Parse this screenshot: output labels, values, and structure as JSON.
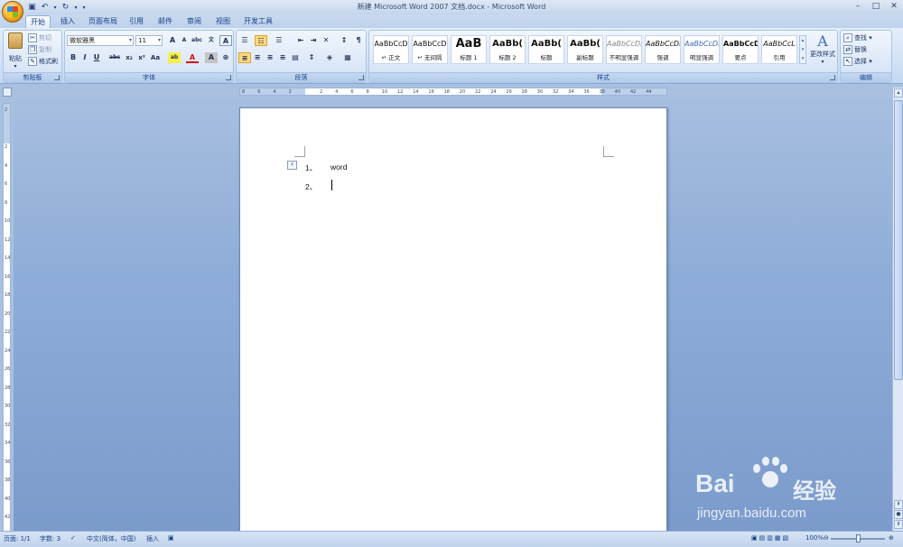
{
  "window": {
    "title": "新建 Microsoft Word 2007 文档.docx - Microsoft Word",
    "controls": [
      "–",
      "□",
      "✕"
    ]
  },
  "qat": {
    "save_icon": "save-icon",
    "undo_icon": "undo-icon",
    "redo_icon": "redo-icon"
  },
  "tabs": [
    {
      "label": "开始",
      "active": true
    },
    {
      "label": "插入"
    },
    {
      "label": "页面布局"
    },
    {
      "label": "引用"
    },
    {
      "label": "邮件"
    },
    {
      "label": "审阅"
    },
    {
      "label": "视图"
    },
    {
      "label": "开发工具"
    }
  ],
  "clipboard": {
    "group_label": "剪贴板",
    "paste": "粘贴",
    "cut": "剪切",
    "copy": "复制",
    "format_painter": "格式刷"
  },
  "font": {
    "group_label": "字体",
    "family": "微软雅黑",
    "size": "11",
    "tools_row1": [
      "A",
      "A",
      "abc",
      "A"
    ],
    "tools_row2": [
      "B",
      "I",
      "U",
      "abc",
      "x₂",
      "x²",
      "Aa",
      "ab",
      "A",
      "A",
      "⊕"
    ]
  },
  "paragraph": {
    "group_label": "段落"
  },
  "styles": {
    "group_label": "样式",
    "items": [
      {
        "sample": "AaBbCcD",
        "name": "↵ 正文"
      },
      {
        "sample": "AaBbCcD",
        "name": "↵ 无间隔"
      },
      {
        "sample": "AaB",
        "name": "标题 1"
      },
      {
        "sample": "AaBb(",
        "name": "标题 2"
      },
      {
        "sample": "AaBb(",
        "name": "标题"
      },
      {
        "sample": "AaBb(",
        "name": "副标题"
      },
      {
        "sample": "AaBbCcDı",
        "name": "不明显强调"
      },
      {
        "sample": "AaBbCcDı",
        "name": "强调"
      },
      {
        "sample": "AaBbCcDı",
        "name": "明显强调"
      },
      {
        "sample": "AaBbCcDc",
        "name": "要点"
      },
      {
        "sample": "AaBbCcL",
        "name": "引用"
      }
    ],
    "change_styles": "更改样式"
  },
  "editing": {
    "group_label": "编辑",
    "find": "查找",
    "replace": "替换",
    "select": "选择"
  },
  "ruler": {
    "h_ticks": [
      "8",
      "6",
      "4",
      "2",
      "",
      "2",
      "4",
      "6",
      "8",
      "10",
      "12",
      "14",
      "16",
      "18",
      "20",
      "22",
      "24",
      "26",
      "28",
      "30",
      "32",
      "34",
      "36",
      "38",
      "40",
      "42",
      "44"
    ],
    "v_ticks": [
      "2",
      "",
      "2",
      "4",
      "6",
      "8",
      "10",
      "12",
      "14",
      "16",
      "18",
      "20",
      "22",
      "24",
      "26",
      "28",
      "30",
      "32",
      "34",
      "36",
      "38",
      "40",
      "42"
    ]
  },
  "document": {
    "autoformat_icon": "autoformat-options-icon",
    "lines": [
      {
        "number": "1、",
        "text": "word"
      },
      {
        "number": "2、",
        "text": ""
      }
    ]
  },
  "statusbar": {
    "page": "页面: 1/1",
    "words": "字数: 3",
    "language": "中文(简体，中国)",
    "mode": "插入",
    "zoom": "100%"
  },
  "watermark": {
    "brand": "Bai",
    "brand_tail": "经验",
    "url": "jingyan.baidu.com"
  }
}
